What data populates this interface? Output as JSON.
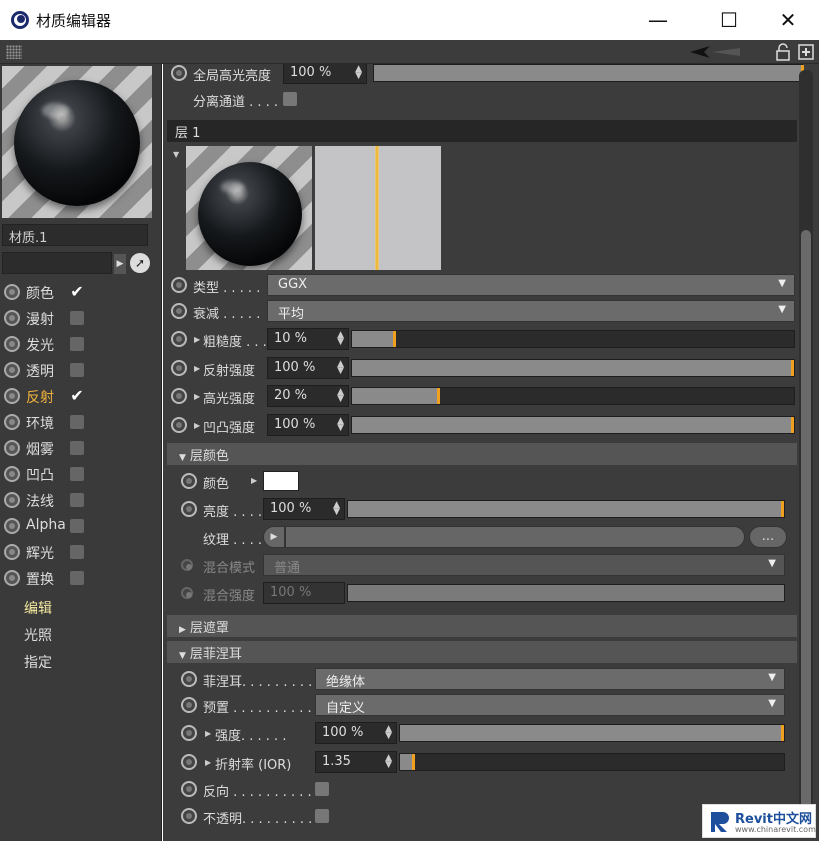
{
  "window": {
    "title": "材质编辑器",
    "minimize": "—",
    "maximize": "☐",
    "close": "✕"
  },
  "material": {
    "name": "材质.1"
  },
  "channels": [
    {
      "label": "颜色",
      "checked": true,
      "active": false
    },
    {
      "label": "漫射",
      "checked": false,
      "active": false
    },
    {
      "label": "发光",
      "checked": false,
      "active": false
    },
    {
      "label": "透明",
      "checked": false,
      "active": false
    },
    {
      "label": "反射",
      "checked": true,
      "active": true
    },
    {
      "label": "环境",
      "checked": false,
      "active": false
    },
    {
      "label": "烟雾",
      "checked": false,
      "active": false
    },
    {
      "label": "凹凸",
      "checked": false,
      "active": false
    },
    {
      "label": "法线",
      "checked": false,
      "active": false
    },
    {
      "label": "Alpha",
      "checked": false,
      "active": false
    },
    {
      "label": "辉光",
      "checked": false,
      "active": false
    },
    {
      "label": "置换",
      "checked": false,
      "active": false
    }
  ],
  "subnav": [
    "编辑",
    "光照",
    "指定"
  ],
  "top": {
    "global_highlight_label": "全局高光亮度",
    "global_highlight_value": "100 %",
    "separate_pass_label": "分离通道 . . . ."
  },
  "layer": {
    "header": "层 1",
    "type_label": "类型 . . . . .",
    "type_value": "GGX",
    "attenuation_label": "衰减 . . . . .",
    "attenuation_value": "平均",
    "roughness_label": "粗糙度 . . .",
    "roughness_value": "10 %",
    "roughness_level": 0.1,
    "reflect_label": "反射强度",
    "reflect_value": "100 %",
    "reflect_level": 1.0,
    "specular_label": "高光强度",
    "specular_value": "20 %",
    "specular_level": 0.2,
    "bump_label": "凹凸强度",
    "bump_value": "100 %",
    "bump_level": 1.0
  },
  "layer_color": {
    "section": "层颜色",
    "color_label": "颜色",
    "color_swatch": "#ffffff",
    "brightness_label": "亮度 . . . .",
    "brightness_value": "100 %",
    "brightness_level": 1.0,
    "texture_label": "纹理 . . . .",
    "texture_more": "...",
    "blend_mode_label": "混合模式",
    "blend_mode_value": "普通",
    "blend_strength_label": "混合强度",
    "blend_strength_value": "100 %",
    "blend_strength_level": 1.0
  },
  "layer_mask": {
    "section": "层遮罩"
  },
  "fresnel": {
    "section": "层菲涅耳",
    "fresnel_label": "菲涅耳. . . . . . . . .",
    "fresnel_value": "绝缘体",
    "preset_label": "预置 . . . . . . . . . .",
    "preset_value": "自定义",
    "strength_label": "强度. . . . . .",
    "strength_value": "100 %",
    "strength_level": 1.0,
    "ior_label": "折射率 (IOR)",
    "ior_value": "1.35",
    "ior_level": 0.04,
    "invert_label": "反向 . . . . . . . . . . .",
    "opaque_label": "不透明. . . . . . . . . ."
  },
  "watermark": {
    "brand": "Revit中文网",
    "url": "www.chinarevit.com"
  }
}
